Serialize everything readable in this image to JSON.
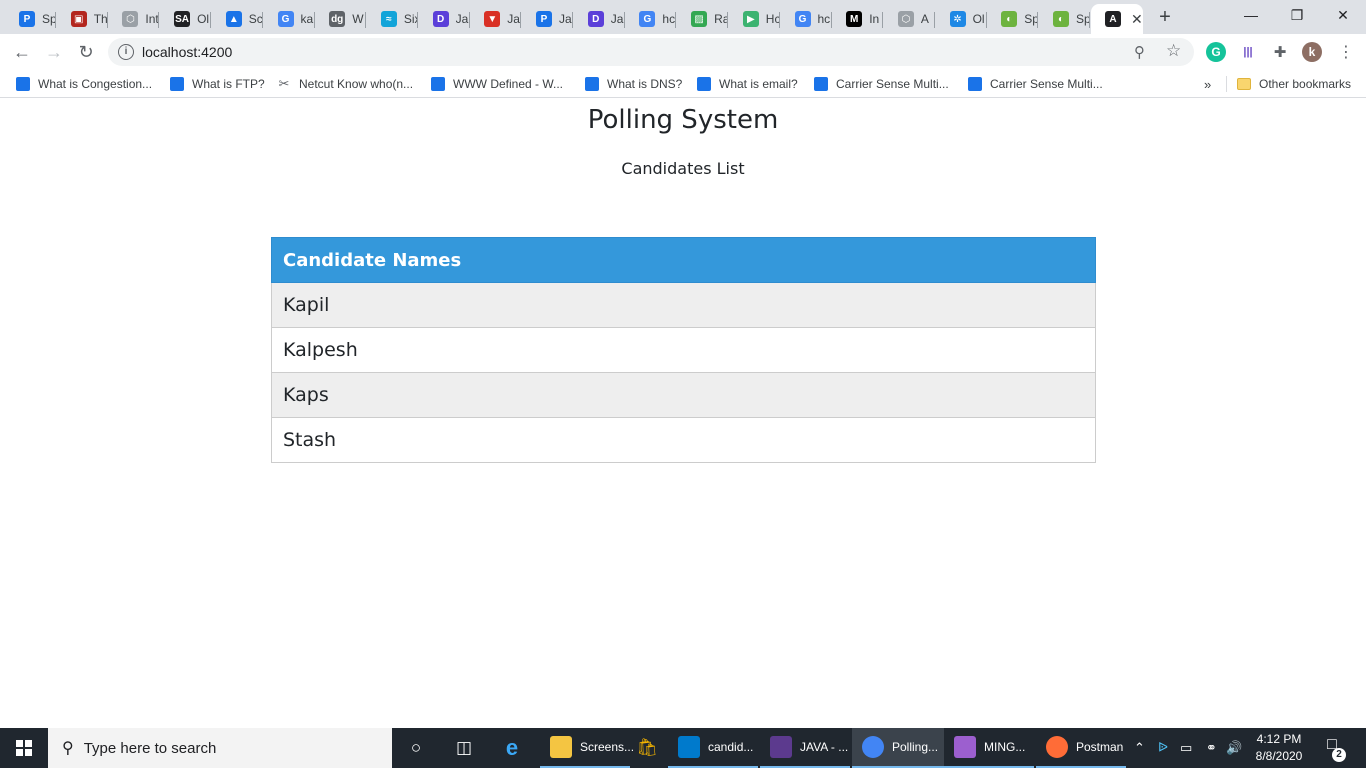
{
  "browser": {
    "tabs": [
      {
        "title": "Sp",
        "color": "#1a73e8",
        "glyph": "P"
      },
      {
        "title": "Th",
        "color": "#b3261e",
        "glyph": "▣"
      },
      {
        "title": "Int",
        "color": "#9aa0a6",
        "glyph": "⬡"
      },
      {
        "title": "Ol",
        "color": "#202124",
        "glyph": "SA"
      },
      {
        "title": "Sc",
        "color": "#1a73e8",
        "glyph": "▲"
      },
      {
        "title": "ka",
        "color": "#4285f4",
        "glyph": "G"
      },
      {
        "title": "W",
        "color": "#5f6368",
        "glyph": "dg"
      },
      {
        "title": "Six",
        "color": "#12a4d9",
        "glyph": "≈"
      },
      {
        "title": "Ja",
        "color": "#5b3fd9",
        "glyph": "D"
      },
      {
        "title": "Ja",
        "color": "#d93025",
        "glyph": "▼"
      },
      {
        "title": "Ja",
        "color": "#1a73e8",
        "glyph": "P"
      },
      {
        "title": "Ja",
        "color": "#5b3fd9",
        "glyph": "D"
      },
      {
        "title": "hc",
        "color": "#4285f4",
        "glyph": "G"
      },
      {
        "title": "Ra",
        "color": "#34a853",
        "glyph": "▨"
      },
      {
        "title": "Hc",
        "color": "#3cb371",
        "glyph": "▶"
      },
      {
        "title": "hc",
        "color": "#4285f4",
        "glyph": "G"
      },
      {
        "title": "In",
        "color": "#000000",
        "glyph": "M"
      },
      {
        "title": "A",
        "color": "#9aa0a6",
        "glyph": "⬡"
      },
      {
        "title": "Ol",
        "color": "#1e88e5",
        "glyph": "✲"
      },
      {
        "title": "Sp",
        "color": "#6db33f",
        "glyph": "◐"
      },
      {
        "title": "Sp",
        "color": "#6db33f",
        "glyph": "◐"
      }
    ],
    "active_tab": {
      "glyph": "A",
      "color": "#202124"
    },
    "new_tab_label": "+",
    "address": "localhost:4200",
    "extensions": [
      {
        "name": "grammarly",
        "glyph": "G",
        "color": "#15c39a"
      },
      {
        "name": "wave",
        "glyph": "|||",
        "color": "#6a4bc4"
      },
      {
        "name": "puzzle",
        "glyph": "✚",
        "color": "#5f6368"
      },
      {
        "name": "profile",
        "glyph": "k",
        "color": "#8d6e63"
      }
    ]
  },
  "bookmarks": {
    "items": [
      "What is Congestion...",
      "What is FTP?",
      "Netcut Know who(n...",
      "WWW Defined - W...",
      "What is DNS?",
      "What is email?",
      "Carrier Sense Multi...",
      "Carrier Sense Multi..."
    ],
    "overflow": "»",
    "other": "Other bookmarks"
  },
  "page": {
    "title": "Polling System",
    "subtitle": "Candidates List",
    "table": {
      "header": "Candidate Names",
      "rows": [
        "Kapil",
        "Kalpesh",
        "Kaps",
        "Stash"
      ]
    }
  },
  "taskbar": {
    "search_placeholder": "Type here to search",
    "apps": [
      {
        "label": "Screens...",
        "color": "#f4c542"
      },
      {
        "label": "candid...",
        "color": "#007acc"
      },
      {
        "label": "JAVA - ...",
        "color": "#5c3a8e"
      },
      {
        "label": "Polling...",
        "color": "#4285f4"
      },
      {
        "label": "MING...",
        "color": "#9c5fcf"
      },
      {
        "label": "Postman",
        "color": "#ff6c37"
      }
    ],
    "time": "4:12 PM",
    "date": "8/8/2020",
    "notifications": "2"
  }
}
